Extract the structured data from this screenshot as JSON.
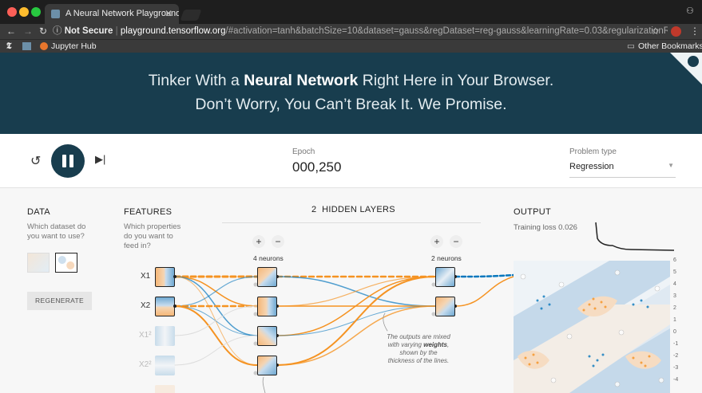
{
  "browser": {
    "tab_title": "A Neural Network Playground",
    "tab_close": "✕",
    "security_label": "Not Secure",
    "url_host": "playground.tensorflow.org",
    "url_path": "/#activation=tanh&batchSize=10&dataset=gauss&regDataset=reg-gauss&learningRate=0.03&regularizationR...",
    "bookmarks": [
      "Jupyter Hub",
      "Other Bookmarks"
    ]
  },
  "hero": {
    "line1_pre": "Tinker With a ",
    "line1_bold": "Neural Network",
    "line1_post": " Right Here in Your Browser.",
    "line2": "Don’t Worry, You Can’t Break It. We Promise."
  },
  "controls": {
    "epoch_label": "Epoch",
    "epoch_value": "000,250",
    "problem_type_label": "Problem type",
    "problem_type_value": "Regression"
  },
  "data": {
    "title": "DATA",
    "subtitle": "Which dataset do you want to use?",
    "regenerate_label": "REGENERATE"
  },
  "features": {
    "title": "FEATURES",
    "subtitle": "Which properties do you want to feed in?",
    "labels": [
      "X1",
      "X2",
      "X1²",
      "X2²"
    ]
  },
  "hidden_layers": {
    "count": "2",
    "label": "HIDDEN LAYERS",
    "plus": "+",
    "minus": "−",
    "layer1_neurons": "4 neurons",
    "layer2_neurons": "2 neurons",
    "annotation_pre": "The outputs are mixed with varying ",
    "annotation_bold": "weights",
    "annotation_post": ", shown by the thickness of the lines."
  },
  "output": {
    "title": "OUTPUT",
    "training_loss": "Training loss 0.026",
    "axis_ticks": [
      "6",
      "5",
      "4",
      "3",
      "2",
      "1",
      "0",
      "-1",
      "-2",
      "-3",
      "-4"
    ]
  },
  "colors": {
    "header_bg": "#183d4e",
    "positive": "#0877bd",
    "negative": "#f59322"
  }
}
